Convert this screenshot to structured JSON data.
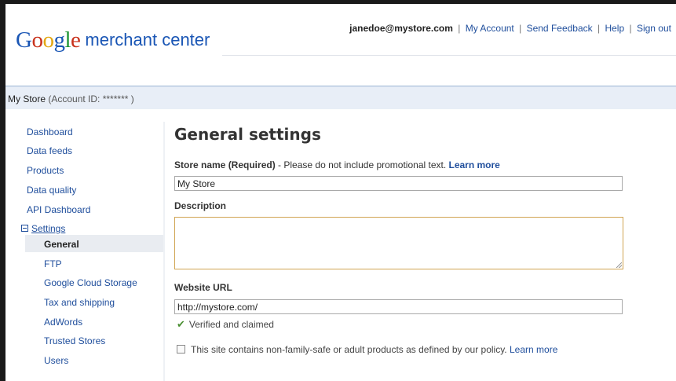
{
  "header": {
    "logo_letters": [
      "G",
      "o",
      "o",
      "g",
      "l",
      "e"
    ],
    "product": "merchant center",
    "email": "janedoe@mystore.com",
    "links": [
      "My Account",
      "Send Feedback",
      "Help",
      "Sign out"
    ],
    "separator": "|"
  },
  "account": {
    "store_name": "My Store",
    "account_id_text": "(Account ID: ******* )"
  },
  "sidebar": {
    "items": [
      "Dashboard",
      "Data feeds",
      "Products",
      "Data quality",
      "API Dashboard"
    ],
    "settings_label": "Settings",
    "settings_expanded_icon": "minus-box-icon",
    "sub_items": [
      "General",
      "FTP",
      "Google Cloud Storage",
      "Tax and shipping",
      "AdWords",
      "Trusted Stores",
      "Users"
    ],
    "active_sub_item": "General"
  },
  "main": {
    "title": "General settings",
    "store_name_label": "Store name (Required)",
    "store_name_hint": " - Please do not include promotional text. ",
    "learn_more": "Learn more",
    "store_name_value": "My Store",
    "description_label": "Description",
    "description_value": "",
    "website_label": "Website URL",
    "website_value": "http://mystore.com/",
    "verified_text": "Verified and claimed",
    "verified_icon": "check-mark-icon",
    "policy_text": "This site contains non-family-safe or adult products as defined by our policy.",
    "policy_learn_more": "Learn more",
    "policy_checked": false
  },
  "colors": {
    "link": "#1f4e9c",
    "account_bar": "#e8eef7",
    "selected_nav": "#e9ecf1",
    "focus_border": "#d0a452",
    "check_green": "#4a8f32"
  }
}
